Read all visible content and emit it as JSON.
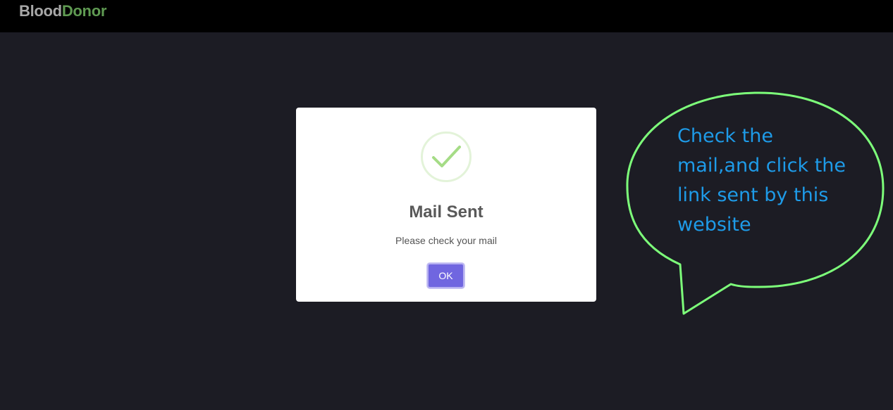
{
  "header": {
    "brand_part1": "Blood",
    "brand_part2": "Donor"
  },
  "dialog": {
    "icon": "checkmark-success-icon",
    "title": "Mail Sent",
    "message": "Please check your mail",
    "ok_label": "OK"
  },
  "annotation": {
    "text": "Check the mail,and click the link sent by this website",
    "outline_color": "#7dff7a",
    "text_color": "#1e9be8"
  },
  "colors": {
    "topbar": "#000000",
    "background": "#1c1c24",
    "brand_gray": "#a8a8a8",
    "brand_green": "#5f9a52",
    "button": "#7066e0",
    "check": "#a5dc86"
  }
}
